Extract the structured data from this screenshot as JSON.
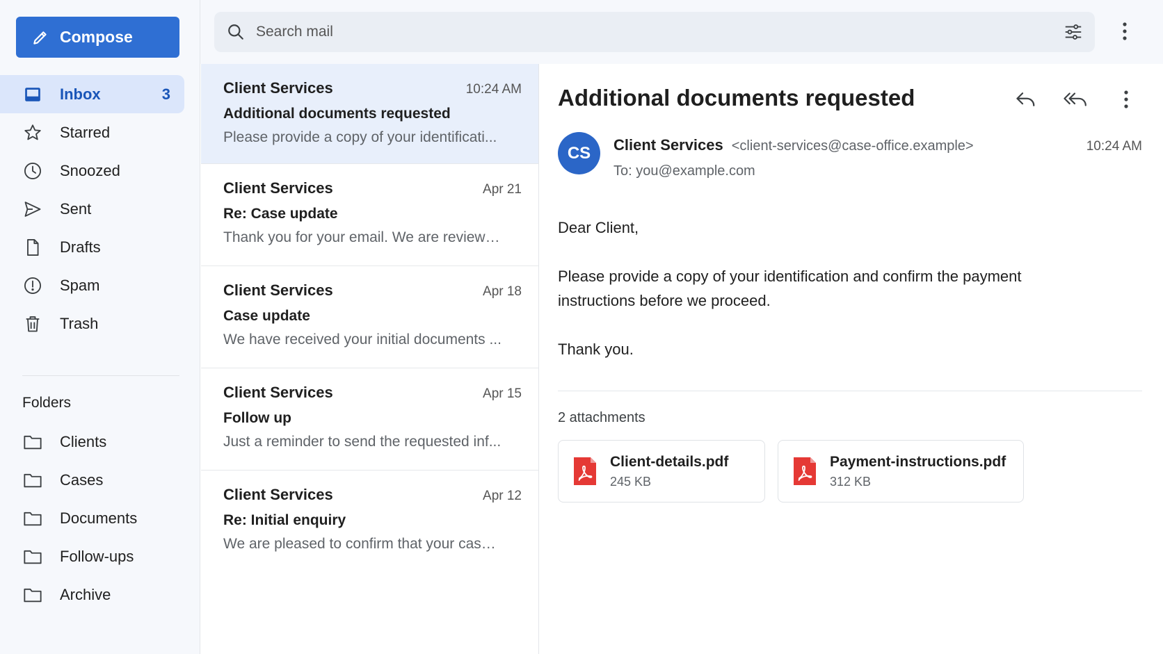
{
  "compose": {
    "label": "Compose",
    "icon": "pencil-icon"
  },
  "nav": [
    {
      "label": "Inbox",
      "count": "3",
      "icon": "inbox-icon",
      "active": true
    },
    {
      "label": "Starred",
      "icon": "star-icon"
    },
    {
      "label": "Snoozed",
      "icon": "clock-icon"
    },
    {
      "label": "Sent",
      "icon": "send-icon"
    },
    {
      "label": "Drafts",
      "icon": "draft-icon"
    },
    {
      "label": "Spam",
      "icon": "spam-icon"
    },
    {
      "label": "Trash",
      "icon": "trash-icon"
    }
  ],
  "folders": {
    "title": "Folders",
    "items": [
      {
        "label": "Clients",
        "icon": "folder-icon"
      },
      {
        "label": "Cases",
        "icon": "folder-icon"
      },
      {
        "label": "Documents",
        "icon": "folder-icon"
      },
      {
        "label": "Follow-ups",
        "icon": "folder-icon"
      },
      {
        "label": "Archive",
        "icon": "folder-icon"
      }
    ]
  },
  "search": {
    "placeholder": "Search mail"
  },
  "messages": [
    {
      "from": "Client Services",
      "date": "10:24 AM",
      "subject": "Additional documents requested",
      "snippet": "Please provide a copy of your identificati...",
      "selected": true
    },
    {
      "from": "Client Services",
      "date": "Apr 21",
      "subject": "Re: Case update",
      "snippet": "Thank you for your email. We are reviewing..."
    },
    {
      "from": "Client Services",
      "date": "Apr 18",
      "subject": "Case update",
      "snippet": "We have received your initial documents ..."
    },
    {
      "from": "Client Services",
      "date": "Apr 15",
      "subject": "Follow up",
      "snippet": "Just a reminder to send the requested inf..."
    },
    {
      "from": "Client Services",
      "date": "Apr 12",
      "subject": "Re: Initial enquiry",
      "snippet": "We are pleased to confirm that your case ..."
    }
  ],
  "email": {
    "subject": "Additional documents requested",
    "avatar_initials": "CS",
    "sender_name": "Client Services",
    "sender_address": "<client-services@case-office.example>",
    "to": "To: you@example.com",
    "time": "10:24 AM",
    "body": [
      "Dear Client,",
      "Please provide a copy of your identification and confirm the payment instructions before we proceed.",
      "Thank you."
    ],
    "attachments_title": "2 attachments",
    "attachments": [
      {
        "name": "Client-details.pdf",
        "size": "245 KB",
        "icon": "pdf-icon"
      },
      {
        "name": "Payment-instructions.pdf",
        "size": "312 KB",
        "icon": "pdf-icon"
      }
    ]
  },
  "colors": {
    "accent": "#2f6fd3",
    "active_bg": "#dbe6fb",
    "selected_bg": "#e8effb",
    "pdf_red": "#e53935"
  }
}
